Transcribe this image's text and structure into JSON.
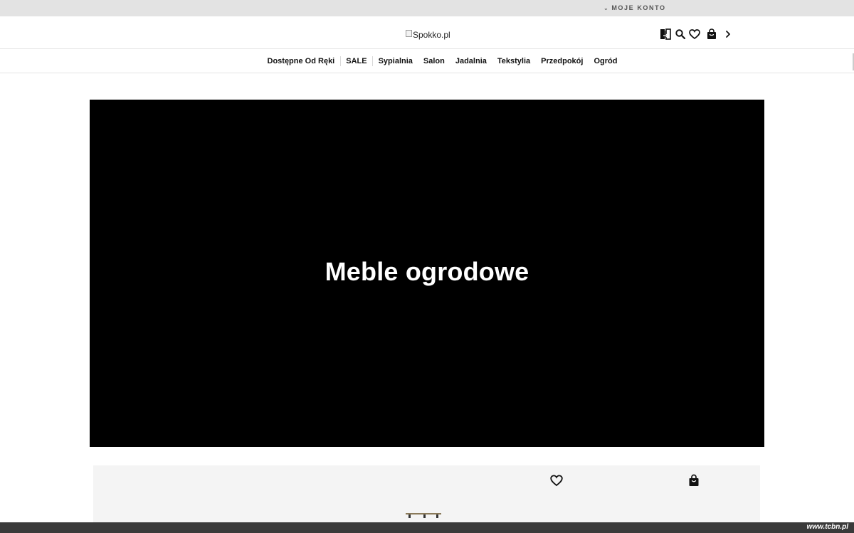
{
  "topbar": {
    "account_label": "MOJE KONTO",
    "account_chevron": "chevron-down-icon"
  },
  "header": {
    "logo_alt": "Spokko.pl",
    "icons": [
      "compare-icon",
      "search-icon",
      "heart-icon",
      "shopping-bag-icon",
      "chevron-right-icon"
    ]
  },
  "nav": {
    "items": [
      {
        "label": "Dostępne Od Ręki"
      },
      {
        "label": "SALE"
      },
      {
        "label": "Sypialnia"
      },
      {
        "label": "Salon"
      },
      {
        "label": "Jadalnia"
      },
      {
        "label": "Tekstylia"
      },
      {
        "label": "Przedpokój"
      },
      {
        "label": "Ogród"
      }
    ]
  },
  "hero": {
    "title": "Meble ogrodowe",
    "background_color": "#000000"
  },
  "product_card": {
    "icons": [
      "heart-icon",
      "shopping-bag-icon"
    ]
  },
  "footer": {
    "watermark": "www.tcbn.pl"
  }
}
